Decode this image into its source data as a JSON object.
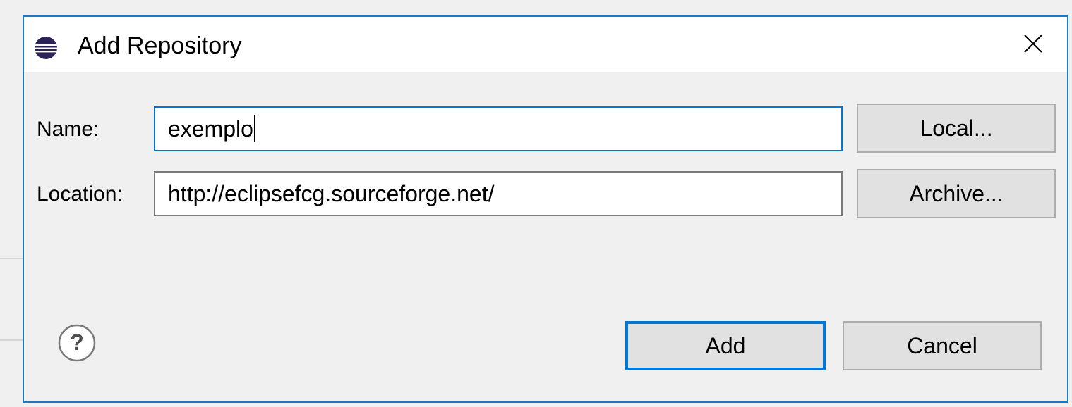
{
  "dialog": {
    "title": "Add Repository",
    "icon": "eclipse-icon",
    "close_icon": "close-icon"
  },
  "form": {
    "name": {
      "label": "Name:",
      "value": "exemplo"
    },
    "location": {
      "label": "Location:",
      "value": "http://eclipsefcg.sourceforge.net/"
    }
  },
  "buttons": {
    "local": "Local...",
    "archive": "Archive...",
    "add": "Add",
    "cancel": "Cancel"
  },
  "footer": {
    "help_icon": "help-icon"
  },
  "colors": {
    "accent": "#0078d7",
    "dialog_border": "#1979ca",
    "background": "#f0f0f0",
    "button_face": "#e1e1e1"
  }
}
